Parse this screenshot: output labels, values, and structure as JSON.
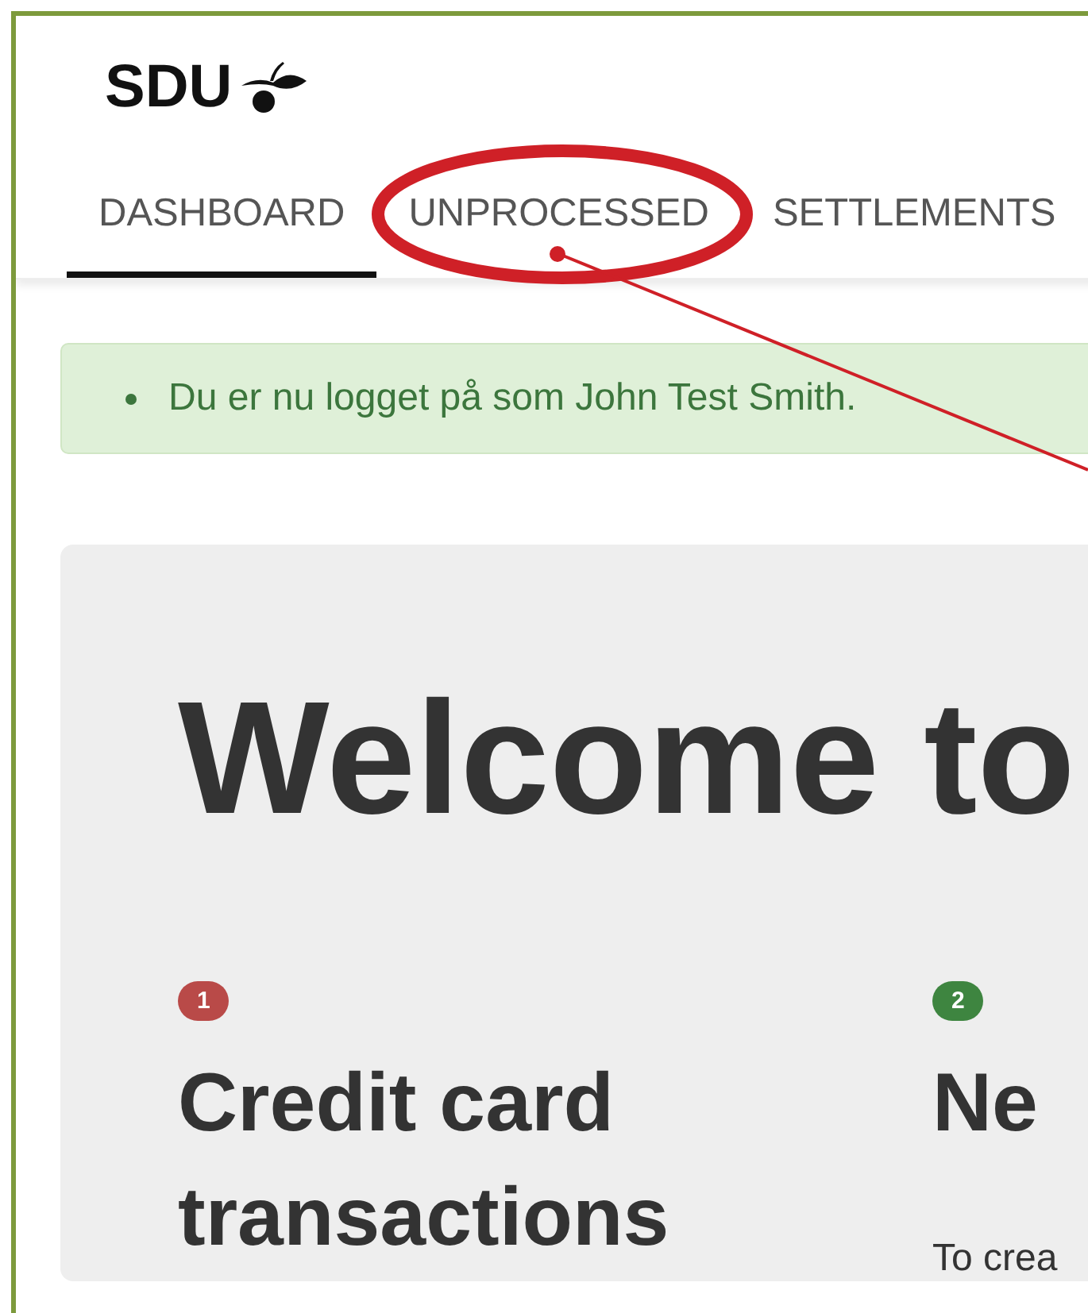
{
  "logo": {
    "text": "SDU"
  },
  "tabs": [
    {
      "label": "DASHBOARD",
      "selected": true
    },
    {
      "label": "UNPROCESSED",
      "selected": false
    },
    {
      "label": "SETTLEMENTS",
      "selected": false
    }
  ],
  "alert": {
    "messages": [
      "Du er nu logget på som John Test Smith."
    ]
  },
  "jumbotron": {
    "title": "Welcome to",
    "steps": [
      {
        "number": "1",
        "color": "#b94a48",
        "title": "Credit card transactions"
      },
      {
        "number": "2",
        "color": "#3e8540",
        "title": "Ne",
        "text": "To crea"
      }
    ]
  }
}
